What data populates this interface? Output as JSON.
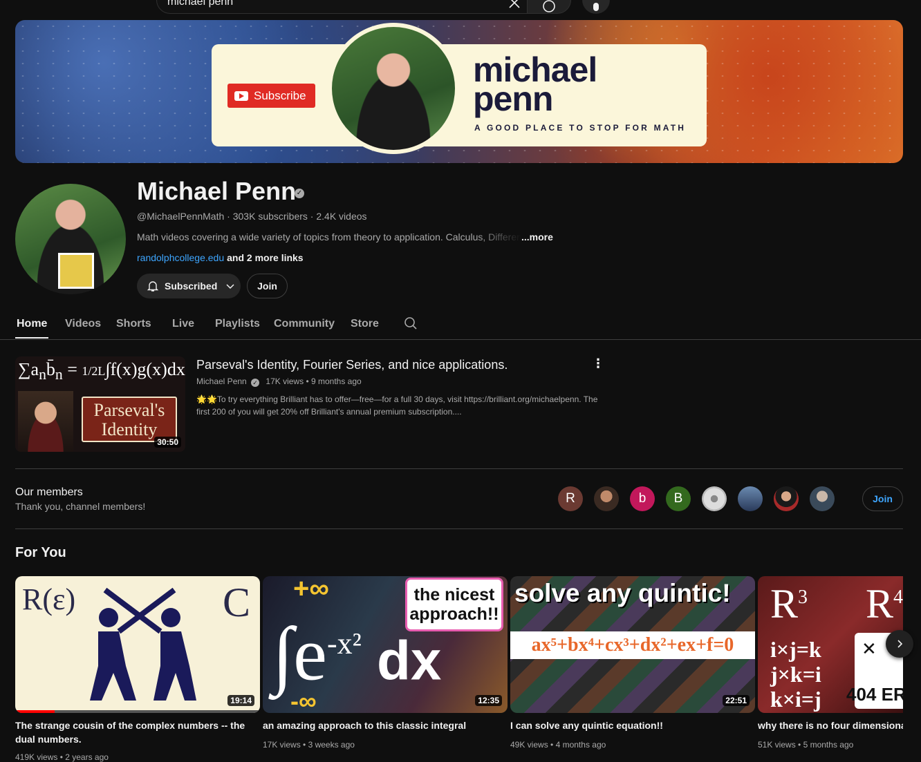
{
  "search": {
    "query": "michael penn"
  },
  "banner": {
    "subscribe_label": "Subscribe",
    "name_line1": "michael",
    "name_line2": "penn",
    "tagline": "A GOOD PLACE TO STOP FOR MATH"
  },
  "channel": {
    "name": "Michael Penn",
    "handle": "@MichaelPennMath",
    "subscribers": "303K subscribers",
    "videos": "2.4K videos",
    "description": "Math videos covering a wide variety of topics from theory to application. Calculus, Differential",
    "more_label": "...more",
    "link": "randolphcollege.edu",
    "more_links": "and 2 more links",
    "subscribed_label": "Subscribed",
    "join_label": "Join"
  },
  "tabs": [
    {
      "label": "Home"
    },
    {
      "label": "Videos"
    },
    {
      "label": "Shorts"
    },
    {
      "label": "Live"
    },
    {
      "label": "Playlists"
    },
    {
      "label": "Community"
    },
    {
      "label": "Store"
    }
  ],
  "featured": {
    "title": "Parseval's Identity, Fourier Series, and nice applications.",
    "channel": "Michael Penn",
    "views": "17K views",
    "age": "9 months ago",
    "description": "🌟🌟To try everything Brilliant has to offer—free—for a full 30 days, visit https://brilliant.org/michaelpenn. The first 200 of you will get 20% off Brilliant's annual premium subscription....",
    "duration": "30:50",
    "thumb_line1": "Parseval's",
    "thumb_line2": "Identity"
  },
  "members": {
    "title": "Our members",
    "subtitle": "Thank you, channel members!",
    "avatars": [
      "R",
      "",
      "b",
      "B",
      "",
      "",
      "",
      ""
    ],
    "join_label": "Join"
  },
  "for_you": {
    "title": "For You",
    "videos": [
      {
        "title": "The strange cousin of the complex numbers -- the dual numbers.",
        "views": "419K views",
        "age": "2 years ago",
        "duration": "19:14"
      },
      {
        "title": "an amazing approach to this classic integral",
        "views": "17K views",
        "age": "3 weeks ago",
        "duration": "12:35",
        "thumb_text": "the nicest approach!!"
      },
      {
        "title": "I can solve any quintic equation!!",
        "views": "49K views",
        "age": "4 months ago",
        "duration": "22:51",
        "thumb_text": "solve any quintic!",
        "equation": "ax⁵+bx⁴+cx³+dx²+ex+f=0"
      },
      {
        "title": "why there is no four dimensional complex numbers",
        "views": "51K views",
        "age": "5 months ago"
      }
    ]
  },
  "colors": {
    "accent_blue": "#3ea6ff",
    "background": "#0f0f0f",
    "subscribe_red": "#e02b24"
  }
}
